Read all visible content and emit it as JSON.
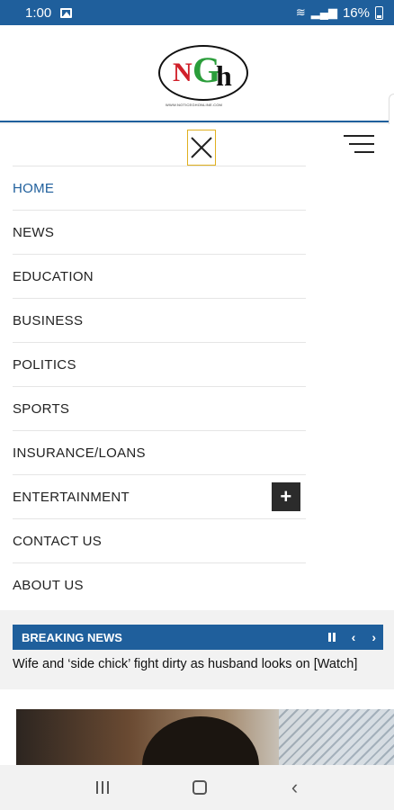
{
  "status_bar": {
    "time": "1:00",
    "battery": "16%"
  },
  "header": {
    "logo_letters": {
      "n": "N",
      "g": "G",
      "h": "h"
    },
    "logo_tagline": "WWW.NOTICEGHONLINE.COM"
  },
  "menu": {
    "items": [
      {
        "label": "HOME",
        "active": true
      },
      {
        "label": "NEWS"
      },
      {
        "label": "EDUCATION"
      },
      {
        "label": "BUSINESS"
      },
      {
        "label": "POLITICS"
      },
      {
        "label": "SPORTS"
      },
      {
        "label": "INSURANCE/LOANS"
      },
      {
        "label": "ENTERTAINMENT",
        "expandable": true,
        "expand_symbol": "+"
      },
      {
        "label": "CONTACT US"
      },
      {
        "label": "ABOUT US"
      }
    ]
  },
  "breaking": {
    "label": "BREAKING NEWS",
    "prev_symbol": "‹",
    "next_symbol": "›",
    "headline": "Wife and ‘side chick’ fight dirty as husband looks on [Watch]"
  },
  "colors": {
    "brand_blue": "#1f5f9c",
    "logo_red": "#d0202a",
    "logo_green": "#2a9d3a"
  },
  "nav_bar": {
    "back_symbol": "‹"
  }
}
